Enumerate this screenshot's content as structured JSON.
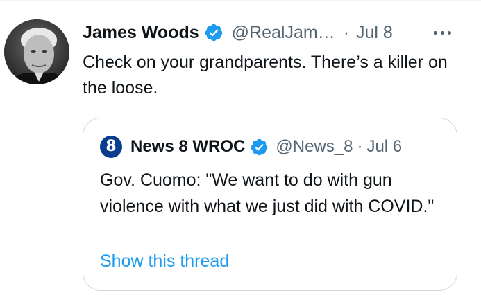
{
  "tweet": {
    "author_name": "James Woods",
    "author_handle": "@RealJam…",
    "separator": "·",
    "date": "Jul 8",
    "text": "Check on your grandparents. There’s a killer on the loose.",
    "more_icon": "more-horizontal-icon"
  },
  "quoted_tweet": {
    "author_name": "News 8 WROC",
    "author_handle": "@News_8",
    "separator": "·",
    "date": "Jul 6",
    "text": "Gov. Cuomo: \"We want to do with gun violence with what we just did with COVID.\"",
    "thread_link": "Show this thread",
    "avatar_number": "8"
  },
  "colors": {
    "verified_blue": "#1d9bf0",
    "secondary_text": "#536471",
    "link": "#1d9bf0",
    "quote_border": "#cfd9de"
  }
}
